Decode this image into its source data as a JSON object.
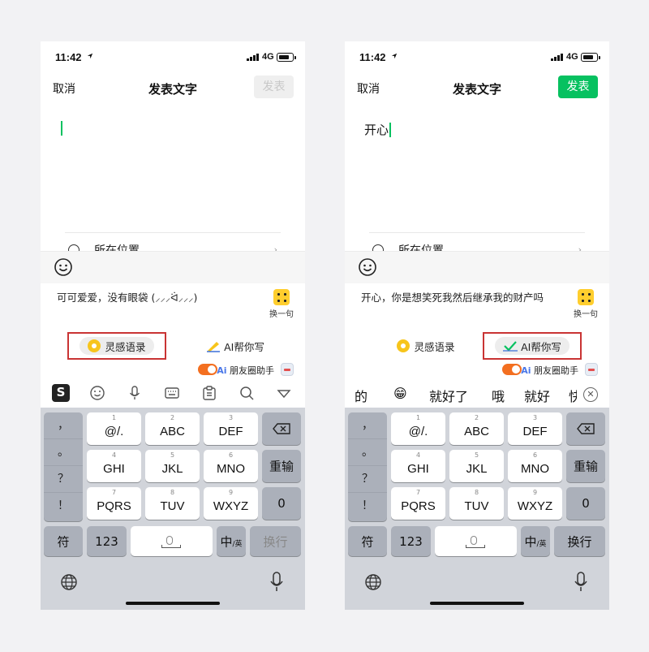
{
  "left": {
    "status": {
      "time": "11:42",
      "network": "4G"
    },
    "nav": {
      "cancel": "取消",
      "title": "发表文字",
      "publish": "发表"
    },
    "compose_text": "",
    "location_label": "所在位置",
    "suggestion": "可可爱爱，没有眼袋 (⸝⸝⸝ᐛ⸝⸝⸝)",
    "shuffle_label": "换一句",
    "tabs": {
      "inspiration": "灵感语录",
      "ai_write": "AI帮你写"
    },
    "assistant": {
      "ai": "Ai",
      "text": "朋友圈助手"
    },
    "keyboard": {
      "punct": [
        "，",
        "。",
        "？",
        "！"
      ],
      "rows": [
        {
          "num": "1",
          "label": "@/."
        },
        {
          "num": "2",
          "label": "ABC"
        },
        {
          "num": "3",
          "label": "DEF"
        },
        {
          "num": "4",
          "label": "GHI"
        },
        {
          "num": "5",
          "label": "JKL"
        },
        {
          "num": "6",
          "label": "MNO"
        },
        {
          "num": "7",
          "label": "PQRS"
        },
        {
          "num": "8",
          "label": "TUV"
        },
        {
          "num": "9",
          "label": "WXYZ"
        }
      ],
      "retype": "重输",
      "zero": "0",
      "symbol": "符",
      "numeric": "123",
      "lang_main": "中",
      "lang_sub": "/英",
      "newline": "换行"
    }
  },
  "right": {
    "status": {
      "time": "11:42",
      "network": "4G"
    },
    "nav": {
      "cancel": "取消",
      "title": "发表文字",
      "publish": "发表"
    },
    "compose_text": "开心",
    "location_label": "所在位置",
    "suggestion": "开心，你是想笑死我然后继承我的财产吗",
    "shuffle_label": "换一句",
    "tabs": {
      "inspiration": "灵感语录",
      "ai_write": "AI帮你写"
    },
    "assistant": {
      "ai": "Ai",
      "text": "朋友圈助手"
    },
    "candidates": [
      "的",
      "😁",
      "就好了",
      "哦",
      "就好",
      "快"
    ],
    "keyboard": {
      "punct": [
        "，",
        "。",
        "？",
        "！"
      ],
      "rows": [
        {
          "num": "1",
          "label": "@/."
        },
        {
          "num": "2",
          "label": "ABC"
        },
        {
          "num": "3",
          "label": "DEF"
        },
        {
          "num": "4",
          "label": "GHI"
        },
        {
          "num": "5",
          "label": "JKL"
        },
        {
          "num": "6",
          "label": "MNO"
        },
        {
          "num": "7",
          "label": "PQRS"
        },
        {
          "num": "8",
          "label": "TUV"
        },
        {
          "num": "9",
          "label": "WXYZ"
        }
      ],
      "retype": "重输",
      "zero": "0",
      "symbol": "符",
      "numeric": "123",
      "lang_main": "中",
      "lang_sub": "/英",
      "newline": "换行"
    }
  },
  "colors": {
    "wechat_green": "#07c160",
    "highlight_red": "#c93434",
    "toggle_orange": "#f36f20"
  },
  "icons": [
    "location-arrow-icon",
    "signal-icon",
    "battery-icon",
    "emoji-icon",
    "dice-icon",
    "bulb-icon",
    "pen-icon",
    "check-icon",
    "sogou-icon",
    "smiley-icon",
    "mic-icon",
    "keyboard-icon",
    "clipboard-icon",
    "search-icon",
    "collapse-icon",
    "backspace-icon",
    "globe-icon",
    "robot-icon",
    "close-icon"
  ]
}
